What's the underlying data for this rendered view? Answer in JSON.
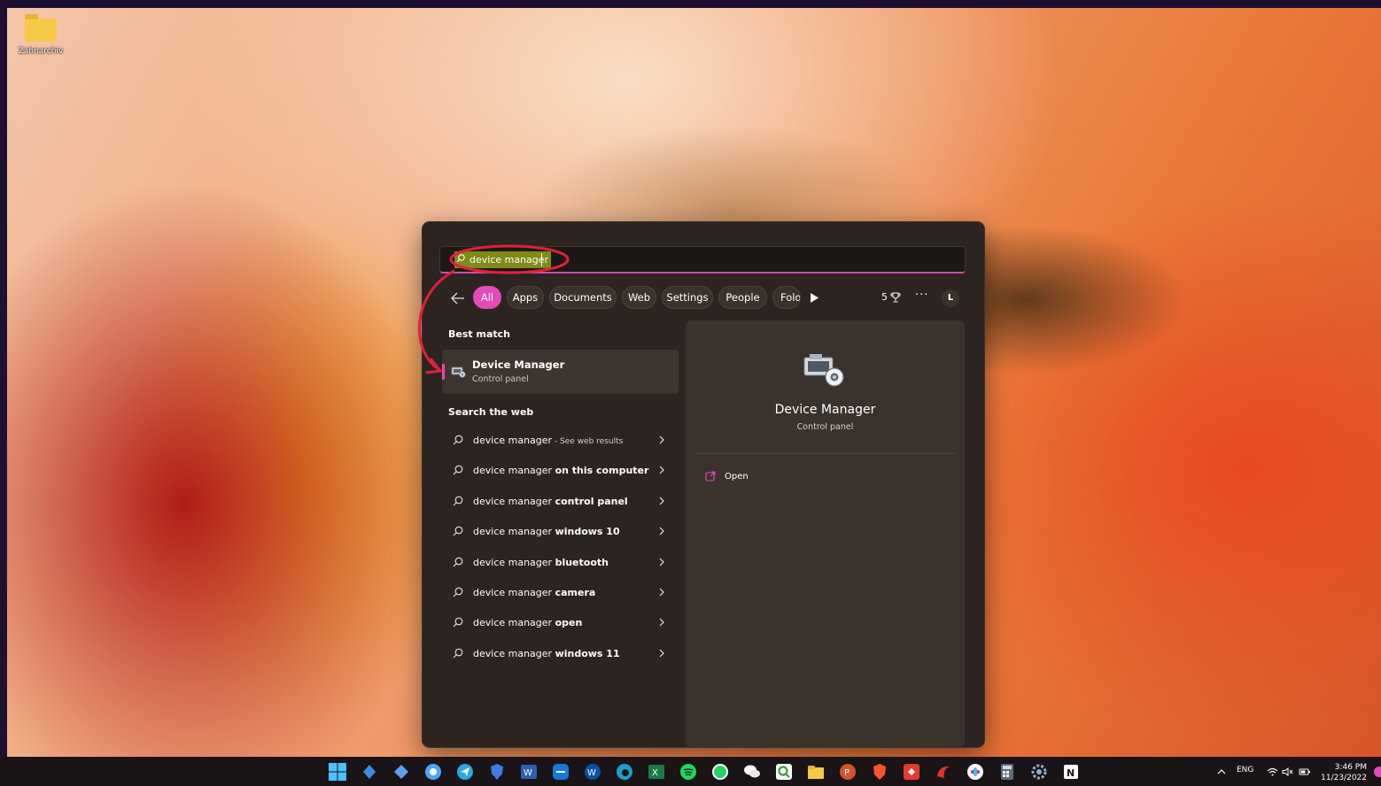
{
  "desktop": {
    "icon_label": "Zahnarchiv"
  },
  "search": {
    "query": "device manager",
    "filters": [
      {
        "label": "All",
        "active": true
      },
      {
        "label": "Apps"
      },
      {
        "label": "Documents"
      },
      {
        "label": "Web"
      },
      {
        "label": "Settings"
      },
      {
        "label": "People"
      },
      {
        "label": "Fold"
      }
    ],
    "points": "5",
    "more": "···",
    "avatar_initial": "L",
    "best_match_heading": "Best match",
    "best_match": {
      "title": "Device Manager",
      "subtitle": "Control panel"
    },
    "web_heading": "Search the web",
    "web_results": [
      {
        "prefix": "device manager",
        "bold": "",
        "suffix": " - See web results"
      },
      {
        "prefix": "device manager ",
        "bold": "on this computer",
        "suffix": ""
      },
      {
        "prefix": "device manager ",
        "bold": "control panel",
        "suffix": ""
      },
      {
        "prefix": "device manager ",
        "bold": "windows 10",
        "suffix": ""
      },
      {
        "prefix": "device manager ",
        "bold": "bluetooth",
        "suffix": ""
      },
      {
        "prefix": "device manager ",
        "bold": "camera",
        "suffix": ""
      },
      {
        "prefix": "device manager ",
        "bold": "open",
        "suffix": ""
      },
      {
        "prefix": "device manager ",
        "bold": "windows 11",
        "suffix": ""
      }
    ],
    "preview": {
      "title": "Device Manager",
      "subtitle": "Control panel",
      "action": "Open"
    }
  },
  "taskbar": {
    "pinned": [
      "start-icon",
      "copilot-icon",
      "app-icon",
      "browser-icon",
      "telegram-icon",
      "shield-icon",
      "word-icon",
      "teamviewer-icon",
      "webex-icon",
      "edge-icon",
      "excel-icon",
      "spotify-icon",
      "whatsapp-icon",
      "wechat-icon",
      "qgis-icon",
      "file-explorer-icon",
      "powerpoint-icon",
      "brave-icon",
      "anydesk-icon",
      "app-red-icon",
      "slack-icon",
      "calculator-icon",
      "settings-icon",
      "notion-icon"
    ],
    "tray": {
      "language": "ENG",
      "time": "3:46 PM",
      "date": "11/23/2022"
    }
  },
  "colors": {
    "accent": "#e24bb8",
    "panel": "#2b2420",
    "annotation": "#e0203a",
    "highlight": "#7f8a17"
  }
}
